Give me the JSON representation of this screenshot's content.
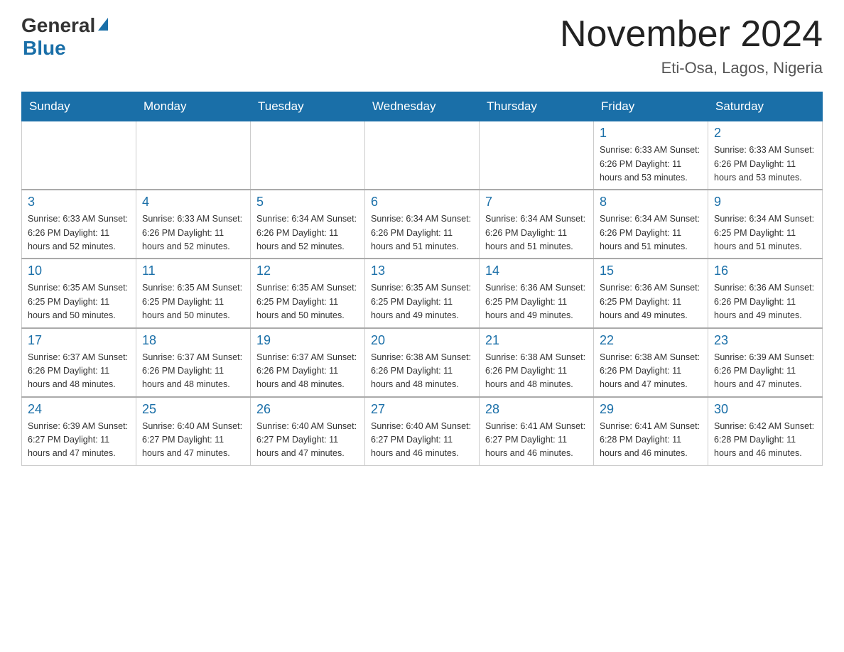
{
  "header": {
    "logo_general": "General",
    "logo_blue": "Blue",
    "month_year": "November 2024",
    "location": "Eti-Osa, Lagos, Nigeria"
  },
  "days_of_week": [
    "Sunday",
    "Monday",
    "Tuesday",
    "Wednesday",
    "Thursday",
    "Friday",
    "Saturday"
  ],
  "weeks": [
    [
      {
        "day": "",
        "info": ""
      },
      {
        "day": "",
        "info": ""
      },
      {
        "day": "",
        "info": ""
      },
      {
        "day": "",
        "info": ""
      },
      {
        "day": "",
        "info": ""
      },
      {
        "day": "1",
        "info": "Sunrise: 6:33 AM\nSunset: 6:26 PM\nDaylight: 11 hours\nand 53 minutes."
      },
      {
        "day": "2",
        "info": "Sunrise: 6:33 AM\nSunset: 6:26 PM\nDaylight: 11 hours\nand 53 minutes."
      }
    ],
    [
      {
        "day": "3",
        "info": "Sunrise: 6:33 AM\nSunset: 6:26 PM\nDaylight: 11 hours\nand 52 minutes."
      },
      {
        "day": "4",
        "info": "Sunrise: 6:33 AM\nSunset: 6:26 PM\nDaylight: 11 hours\nand 52 minutes."
      },
      {
        "day": "5",
        "info": "Sunrise: 6:34 AM\nSunset: 6:26 PM\nDaylight: 11 hours\nand 52 minutes."
      },
      {
        "day": "6",
        "info": "Sunrise: 6:34 AM\nSunset: 6:26 PM\nDaylight: 11 hours\nand 51 minutes."
      },
      {
        "day": "7",
        "info": "Sunrise: 6:34 AM\nSunset: 6:26 PM\nDaylight: 11 hours\nand 51 minutes."
      },
      {
        "day": "8",
        "info": "Sunrise: 6:34 AM\nSunset: 6:26 PM\nDaylight: 11 hours\nand 51 minutes."
      },
      {
        "day": "9",
        "info": "Sunrise: 6:34 AM\nSunset: 6:25 PM\nDaylight: 11 hours\nand 51 minutes."
      }
    ],
    [
      {
        "day": "10",
        "info": "Sunrise: 6:35 AM\nSunset: 6:25 PM\nDaylight: 11 hours\nand 50 minutes."
      },
      {
        "day": "11",
        "info": "Sunrise: 6:35 AM\nSunset: 6:25 PM\nDaylight: 11 hours\nand 50 minutes."
      },
      {
        "day": "12",
        "info": "Sunrise: 6:35 AM\nSunset: 6:25 PM\nDaylight: 11 hours\nand 50 minutes."
      },
      {
        "day": "13",
        "info": "Sunrise: 6:35 AM\nSunset: 6:25 PM\nDaylight: 11 hours\nand 49 minutes."
      },
      {
        "day": "14",
        "info": "Sunrise: 6:36 AM\nSunset: 6:25 PM\nDaylight: 11 hours\nand 49 minutes."
      },
      {
        "day": "15",
        "info": "Sunrise: 6:36 AM\nSunset: 6:25 PM\nDaylight: 11 hours\nand 49 minutes."
      },
      {
        "day": "16",
        "info": "Sunrise: 6:36 AM\nSunset: 6:26 PM\nDaylight: 11 hours\nand 49 minutes."
      }
    ],
    [
      {
        "day": "17",
        "info": "Sunrise: 6:37 AM\nSunset: 6:26 PM\nDaylight: 11 hours\nand 48 minutes."
      },
      {
        "day": "18",
        "info": "Sunrise: 6:37 AM\nSunset: 6:26 PM\nDaylight: 11 hours\nand 48 minutes."
      },
      {
        "day": "19",
        "info": "Sunrise: 6:37 AM\nSunset: 6:26 PM\nDaylight: 11 hours\nand 48 minutes."
      },
      {
        "day": "20",
        "info": "Sunrise: 6:38 AM\nSunset: 6:26 PM\nDaylight: 11 hours\nand 48 minutes."
      },
      {
        "day": "21",
        "info": "Sunrise: 6:38 AM\nSunset: 6:26 PM\nDaylight: 11 hours\nand 48 minutes."
      },
      {
        "day": "22",
        "info": "Sunrise: 6:38 AM\nSunset: 6:26 PM\nDaylight: 11 hours\nand 47 minutes."
      },
      {
        "day": "23",
        "info": "Sunrise: 6:39 AM\nSunset: 6:26 PM\nDaylight: 11 hours\nand 47 minutes."
      }
    ],
    [
      {
        "day": "24",
        "info": "Sunrise: 6:39 AM\nSunset: 6:27 PM\nDaylight: 11 hours\nand 47 minutes."
      },
      {
        "day": "25",
        "info": "Sunrise: 6:40 AM\nSunset: 6:27 PM\nDaylight: 11 hours\nand 47 minutes."
      },
      {
        "day": "26",
        "info": "Sunrise: 6:40 AM\nSunset: 6:27 PM\nDaylight: 11 hours\nand 47 minutes."
      },
      {
        "day": "27",
        "info": "Sunrise: 6:40 AM\nSunset: 6:27 PM\nDaylight: 11 hours\nand 46 minutes."
      },
      {
        "day": "28",
        "info": "Sunrise: 6:41 AM\nSunset: 6:27 PM\nDaylight: 11 hours\nand 46 minutes."
      },
      {
        "day": "29",
        "info": "Sunrise: 6:41 AM\nSunset: 6:28 PM\nDaylight: 11 hours\nand 46 minutes."
      },
      {
        "day": "30",
        "info": "Sunrise: 6:42 AM\nSunset: 6:28 PM\nDaylight: 11 hours\nand 46 minutes."
      }
    ]
  ]
}
